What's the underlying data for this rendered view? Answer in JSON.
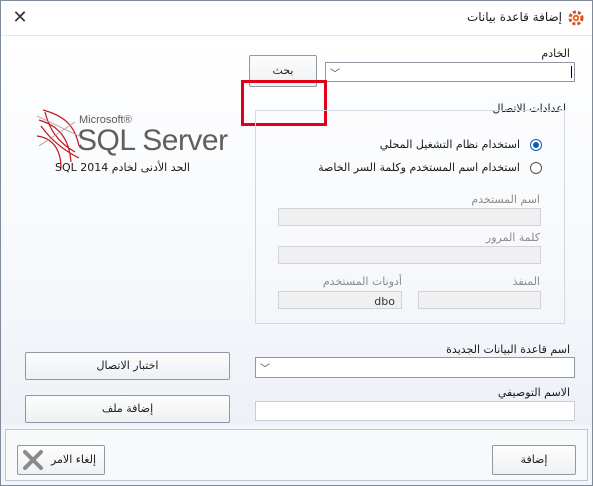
{
  "window": {
    "title": "إضافة قاعدة بيانات",
    "close_icon": "close-icon",
    "app_icon": "gear-icon"
  },
  "logo": {
    "brand_small": "Microsoft®",
    "brand_large": "SQL Server",
    "reg": "®"
  },
  "min_version_note": "الحد الأدنى لخادم SQL 2014",
  "server": {
    "label": "الخادم",
    "value": "",
    "browse_label": "بحث"
  },
  "connection": {
    "group_label": "اعدادات الاتصال",
    "windows_auth_label": "استخدام نظام التشغيل المحلي",
    "sql_auth_label": "استخدام اسم المستخدم وكلمة السر الخاصة",
    "selected": "windows",
    "username_label": "اسم المستخدم",
    "username_value": "",
    "password_label": "كلمة المرور",
    "password_value": "",
    "port_label": "المنفذ",
    "port_value": "",
    "schema_label": "أدونات المستخدم",
    "schema_value": "dbo"
  },
  "new_database": {
    "label": "اسم قاعدة البيانات الجديدة",
    "value": ""
  },
  "description": {
    "label": "الاسم التوصيفي",
    "value": ""
  },
  "buttons": {
    "test_connection": "اختبار الاتصال",
    "add_file": "إضافة ملف",
    "add": "إضافة",
    "cancel": "إلغاء الامر"
  },
  "colors": {
    "highlight_border": "#e0001a",
    "radio_selected": "#0a5fb4",
    "logo_red": "#c4161c"
  }
}
